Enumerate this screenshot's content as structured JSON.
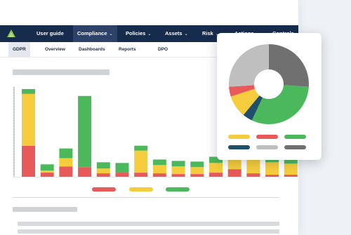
{
  "nav": {
    "items": [
      {
        "label": "User guide",
        "active": false
      },
      {
        "label": "Compliance",
        "active": true
      },
      {
        "label": "Policies",
        "active": false
      },
      {
        "label": "Assets",
        "active": false
      },
      {
        "label": "Risk",
        "active": false
      },
      {
        "label": "Actions",
        "active": false
      },
      {
        "label": "Controls",
        "active": false
      }
    ]
  },
  "subnav": {
    "items": [
      {
        "label": "GDPR",
        "active": true
      },
      {
        "label": "Overview"
      },
      {
        "label": "Dashboards"
      },
      {
        "label": "Reports"
      },
      {
        "label": "DPO"
      }
    ]
  },
  "colors": {
    "navy": "#172b4d",
    "red": "#e85a5a",
    "yellow": "#f5cd3c",
    "green": "#4cb85c",
    "dark_teal": "#1f4f6b",
    "light_gray": "#bfbfbf",
    "dark_gray": "#707070"
  },
  "chart_data": [
    {
      "type": "bar",
      "stacked": true,
      "categories": [
        "",
        "",
        "",
        "",
        "",
        "",
        "",
        "",
        "",
        "",
        "",
        "",
        "",
        "",
        "",
        ""
      ],
      "series": [
        {
          "color": "red",
          "values": [
            45,
            6,
            15,
            14,
            5,
            6,
            6,
            5,
            4,
            4,
            6,
            11,
            5,
            3,
            3,
            5
          ]
        },
        {
          "color": "yellow",
          "values": [
            75,
            3,
            12,
            0,
            7,
            0,
            32,
            12,
            11,
            10,
            14,
            14,
            25,
            18,
            16,
            17
          ]
        },
        {
          "color": "green",
          "values": [
            7,
            9,
            14,
            103,
            9,
            14,
            7,
            8,
            8,
            8,
            9,
            30,
            9,
            9,
            12,
            17
          ]
        }
      ],
      "ylim": [
        0,
        130
      ],
      "legend": "bottom-center",
      "grid": false
    },
    {
      "type": "pie",
      "donut": true,
      "slices": [
        {
          "color": "dark_gray",
          "value": 26
        },
        {
          "color": "green",
          "value": 31
        },
        {
          "color": "dark_teal",
          "value": 4
        },
        {
          "color": "yellow",
          "value": 9
        },
        {
          "color": "red",
          "value": 4
        },
        {
          "color": "light_gray",
          "value": 26
        }
      ],
      "legend": "bottom",
      "legend_order": [
        "yellow",
        "red",
        "green",
        "dark_teal",
        "light_gray",
        "dark_gray"
      ]
    }
  ]
}
